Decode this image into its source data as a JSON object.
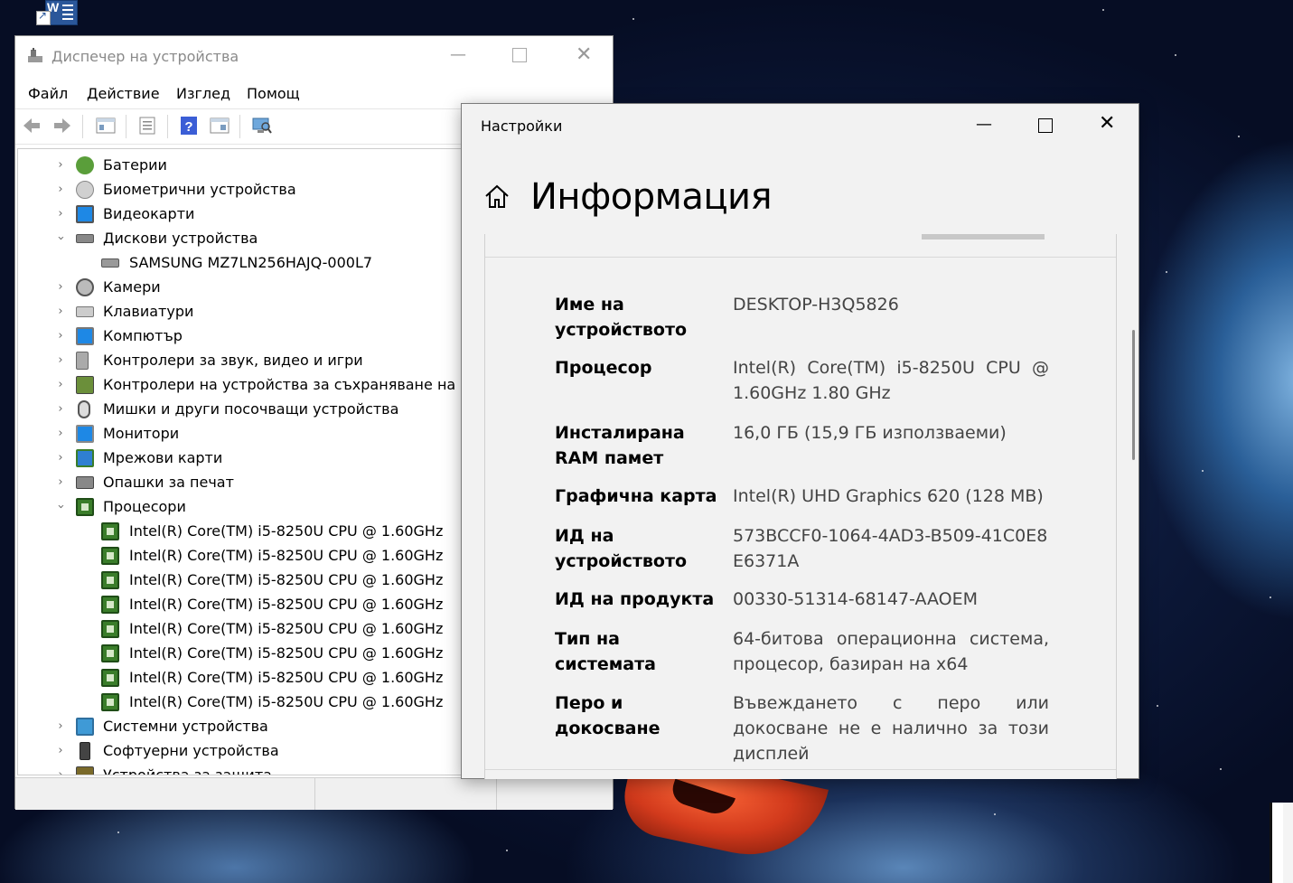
{
  "device_manager": {
    "title": "Диспечер на устройства",
    "menu": [
      "Файл",
      "Действие",
      "Изглед",
      "Помощ"
    ],
    "tree": [
      {
        "label": "Батерии",
        "expanded": false,
        "level": 0
      },
      {
        "label": "Биометрични устройства",
        "expanded": false,
        "level": 0
      },
      {
        "label": "Видеокарти",
        "expanded": false,
        "level": 0
      },
      {
        "label": "Дискови устройства",
        "expanded": true,
        "level": 0
      },
      {
        "label": "SAMSUNG MZ7LN256HAJQ-000L7",
        "level": 1
      },
      {
        "label": "Камери",
        "expanded": false,
        "level": 0
      },
      {
        "label": "Клавиатури",
        "expanded": false,
        "level": 0
      },
      {
        "label": "Компютър",
        "expanded": false,
        "level": 0
      },
      {
        "label": "Контролери за звук, видео и игри",
        "expanded": false,
        "level": 0
      },
      {
        "label": "Контролери на устройства за съхраняване на дан",
        "expanded": false,
        "level": 0
      },
      {
        "label": "Мишки и други посочващи устройства",
        "expanded": false,
        "level": 0
      },
      {
        "label": "Монитори",
        "expanded": false,
        "level": 0
      },
      {
        "label": "Мрежови карти",
        "expanded": false,
        "level": 0
      },
      {
        "label": "Опашки за печат",
        "expanded": false,
        "level": 0
      },
      {
        "label": "Процесори",
        "expanded": true,
        "level": 0
      },
      {
        "label": "Intel(R) Core(TM) i5-8250U CPU @ 1.60GHz",
        "level": 1
      },
      {
        "label": "Intel(R) Core(TM) i5-8250U CPU @ 1.60GHz",
        "level": 1
      },
      {
        "label": "Intel(R) Core(TM) i5-8250U CPU @ 1.60GHz",
        "level": 1
      },
      {
        "label": "Intel(R) Core(TM) i5-8250U CPU @ 1.60GHz",
        "level": 1
      },
      {
        "label": "Intel(R) Core(TM) i5-8250U CPU @ 1.60GHz",
        "level": 1
      },
      {
        "label": "Intel(R) Core(TM) i5-8250U CPU @ 1.60GHz",
        "level": 1
      },
      {
        "label": "Intel(R) Core(TM) i5-8250U CPU @ 1.60GHz",
        "level": 1
      },
      {
        "label": "Intel(R) Core(TM) i5-8250U CPU @ 1.60GHz",
        "level": 1
      },
      {
        "label": "Системни устройства",
        "expanded": false,
        "level": 0
      },
      {
        "label": "Софтуерни устройства",
        "expanded": false,
        "level": 0
      },
      {
        "label": "Устройства за защита",
        "expanded": false,
        "level": 0
      }
    ]
  },
  "settings": {
    "title": "Настройки",
    "page_title": "Информация",
    "specs": [
      {
        "key": "Име на устройството",
        "value": "DESKTOP-H3Q5826"
      },
      {
        "key": "Процесор",
        "value": "Intel(R) Core(TM) i5-8250U CPU @ 1.60GHz 1.80 GHz"
      },
      {
        "key": "Инсталирана RAM памет",
        "value": "16,0 ГБ (15,9 ГБ използваеми)"
      },
      {
        "key": "Графична карта",
        "value": "Intel(R) UHD Graphics 620 (128 MB)"
      },
      {
        "key": "ИД на устройството",
        "value": "573BCCF0-1064-4AD3-B509-41C0E8E6371A"
      },
      {
        "key": "ИД на продукта",
        "value": "00330-51314-68147-AAOEM"
      },
      {
        "key": "Тип на системата",
        "value": "64-битова операционна система, процесор, базиран на x64"
      },
      {
        "key": "Перо и докосване",
        "value": "Въвеждането с перо или докосване не е налично за този дисплей"
      }
    ]
  },
  "desktop": {
    "shortcut_letter": "W"
  },
  "colors": {
    "cpu_icon": "#3a7d2a",
    "settings_bg": "#f2f2f2",
    "monitor_icon": "#1e88e5"
  }
}
